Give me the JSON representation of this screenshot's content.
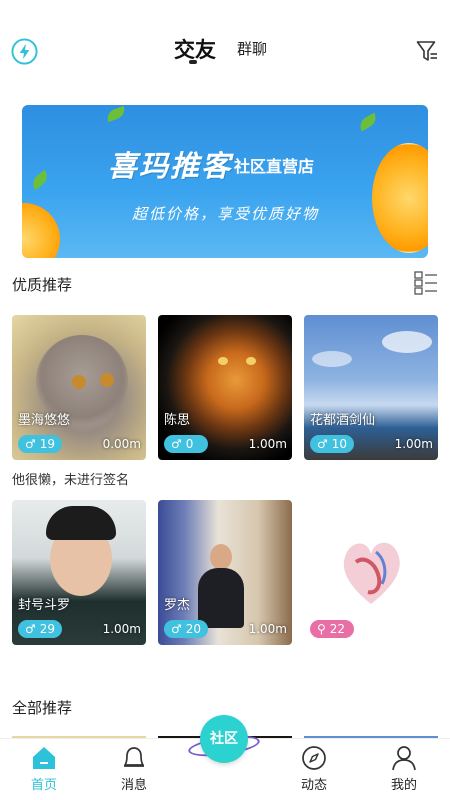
{
  "header": {
    "main_tab": "交友",
    "second_tab": "群聊"
  },
  "banner": {
    "title": "喜玛推客",
    "title_small": "社区直营店",
    "subtitle": "超低价格，享受优质好物"
  },
  "quality": {
    "title": "优质推荐",
    "signature_text": "他很懒，未进行签名",
    "cards": [
      {
        "name": "墨海悠悠",
        "gender": "♂",
        "count": "19",
        "distance": "0.00m"
      },
      {
        "name": "陈思",
        "gender": "♂",
        "count": "0",
        "distance": "1.00m"
      },
      {
        "name": "花都酒剑仙",
        "gender": "♂",
        "count": "10",
        "distance": "1.00m"
      },
      {
        "name": "封号斗罗",
        "gender": "♂",
        "count": "29",
        "distance": "1.00m"
      },
      {
        "name": "罗杰",
        "gender": "♂",
        "count": "20",
        "distance": "1.00m"
      },
      {
        "name": "",
        "gender": "⚲",
        "count": "22",
        "distance": ""
      }
    ]
  },
  "all_section": {
    "title": "全部推荐"
  },
  "nav": {
    "home": "首页",
    "messages": "消息",
    "community": "社区",
    "moments": "动态",
    "mine": "我的"
  },
  "colors": {
    "accent": "#2cc2d9",
    "male_badge": "#3fc1df",
    "female_badge": "#e86fa6"
  },
  "icons": [
    "flash-icon",
    "filter-icon",
    "grid-list-icon",
    "home-icon",
    "bell-icon",
    "compass-icon",
    "person-icon"
  ]
}
